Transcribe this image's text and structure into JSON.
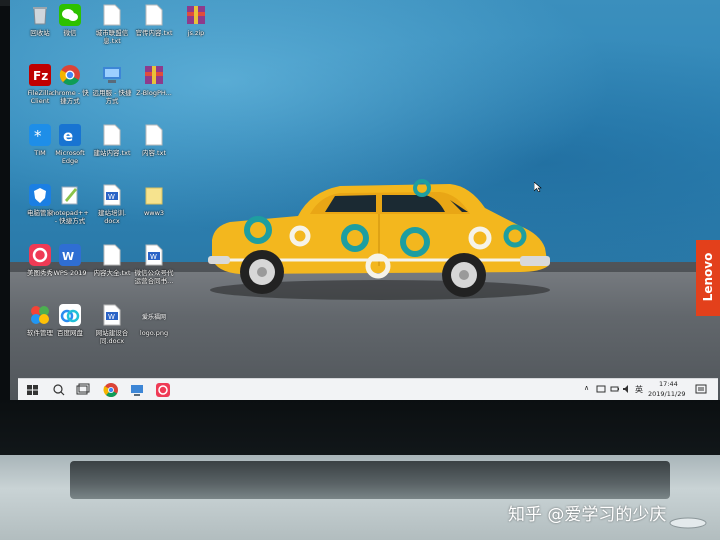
{
  "desktop": {
    "icons": [
      {
        "label": "回收站"
      },
      {
        "label": "微信"
      },
      {
        "label": "城市联盟信\n息.txt"
      },
      {
        "label": "官传内容.txt"
      },
      {
        "label": "js.zip"
      },
      {
        "label": "FileZilla\nClient"
      },
      {
        "label": "chrome - 快\n捷方式"
      },
      {
        "label": "远用服 - 快捷\n方式"
      },
      {
        "label": "Z-BlogPH..."
      },
      {
        "label": "TIM"
      },
      {
        "label": "Microsoft\nEdge"
      },
      {
        "label": "建站内容.txt"
      },
      {
        "label": "内容.txt"
      },
      {
        "label": "电脑管家"
      },
      {
        "label": "notepad++\n- 快捷方式"
      },
      {
        "label": "建站培训.\ndocx"
      },
      {
        "label": "www3"
      },
      {
        "label": "美图秀秀"
      },
      {
        "label": "WPS 2019"
      },
      {
        "label": "内容大全.txt"
      },
      {
        "label": "微信公众号代\n运营合同书..."
      },
      {
        "label": "软件管理"
      },
      {
        "label": "百度网盘"
      },
      {
        "label": "网站建设合\n同.docx"
      },
      {
        "label": "logo.png"
      }
    ],
    "logo_caption": "爱乐福网"
  },
  "brand_tag": "Lenovo",
  "taskbar": {
    "time": "17:44",
    "date": "2019/11/29",
    "ime": "英"
  },
  "watermark": "知乎 @爱学习的少庆",
  "colors": {
    "wall": "#2f86b8",
    "car": "#f3b71e",
    "lenovo": "#e3401b",
    "taskbar": "#f2f3f5"
  }
}
